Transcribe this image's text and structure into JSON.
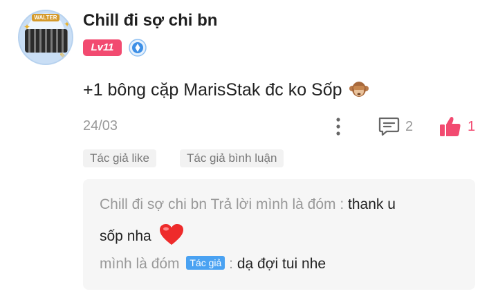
{
  "post": {
    "username": "Chill đi sợ chi bn",
    "avatar_banner_text": "WALTER",
    "level": "Lv11",
    "text": "+1 bông cặp MarisStak đc ko Sốp",
    "date": "24/03",
    "reply_count": "2",
    "like_count": "1",
    "icons": [
      "avatar",
      "verified-badge-icon",
      "see-no-evil-monkey-icon",
      "more-vertical-icon",
      "comment-icon",
      "thumbs-up-icon"
    ]
  },
  "tags": {
    "author_liked": "Tác giả like",
    "author_replied": "Tác giả bình luận"
  },
  "replies": {
    "r1_name": "Chill đi sợ chi bn Trả lời mình là đóm :",
    "r1_msg_a": "thank u",
    "r1_msg_b": "sốp nha",
    "r2_name": "mình là đóm",
    "r2_badge": "Tác giả",
    "r2_colon": ":",
    "r2_msg": "dạ đợi tui nhe"
  },
  "colors": {
    "accent_pink": "#f24a70",
    "author_badge_blue": "#4aa2f2",
    "muted_text": "#999999"
  }
}
